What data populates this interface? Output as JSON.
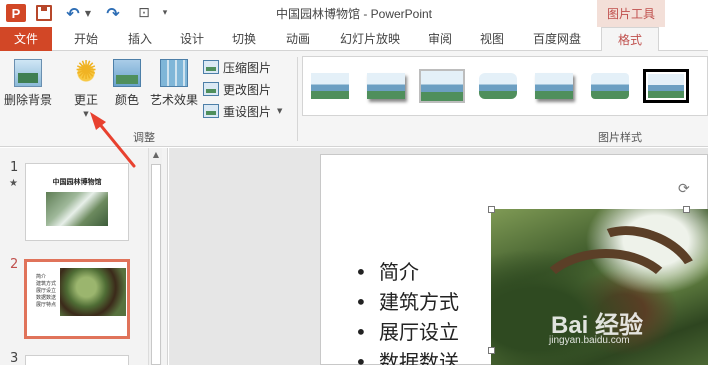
{
  "title_bar": {
    "app_icon_letter": "P",
    "title": "中国园林博物馆 - PowerPoint",
    "context_tab_title": "图片工具",
    "icons": [
      "powerpoint-logo-icon",
      "save-icon",
      "undo-icon",
      "redo-icon",
      "start-presentation-icon",
      "customize-toolbar-icon"
    ]
  },
  "tabs": [
    "文件",
    "开始",
    "插入",
    "设计",
    "切换",
    "动画",
    "幻灯片放映",
    "审阅",
    "视图",
    "百度网盘",
    "格式"
  ],
  "active_tab": "格式",
  "ribbon": {
    "remove_background": "删除背景",
    "corrections": "更正",
    "color": "颜色",
    "artistic_effects": "艺术效果",
    "compress_pictures": "压缩图片",
    "change_picture": "更改图片",
    "reset_picture": "重设图片",
    "adjust_group": "调整",
    "picture_styles_group": "图片样式"
  },
  "annotation": {
    "color": "#e8412f",
    "points_to": "corrections-button"
  },
  "slides_pane": {
    "slides": [
      {
        "number": "1",
        "has_animation_star": true,
        "title": "中国园林博物馆"
      },
      {
        "number": "2",
        "selected": true,
        "bullets": [
          "简介",
          "建筑方式",
          "展厅设立",
          "数据数送",
          "展厅特点"
        ]
      },
      {
        "number": "3"
      }
    ]
  },
  "slide": {
    "bullets": [
      "简介",
      "建筑方式",
      "展厅设立",
      "数据数送"
    ],
    "watermark": "Bai 经验",
    "watermark_sub": "jingyan.baidu.com"
  },
  "colors": {
    "file_tab": "#d24726",
    "accent": "#c0504d",
    "context_tab_bg": "#f3dfd8",
    "selection_border": "#e0735a"
  }
}
